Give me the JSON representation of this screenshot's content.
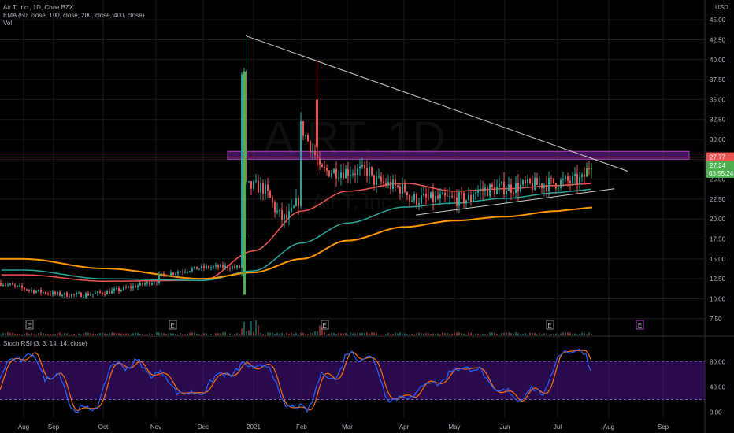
{
  "header": {
    "symbol_line": "Air T, Inc., 1D, Cboe BZX",
    "ema_line": "EMA (50, close, 100, close, 200, close, 400, close)",
    "vol_line": "Vol",
    "watermark": "AIRT, 1D",
    "watermark_sub": "Air T, Inc."
  },
  "currency": "USD",
  "rsi": {
    "legend": "Stoch RSI (3, 3, 14, 14, close)"
  },
  "price_tags": {
    "resistance": "27.77",
    "last_price": "27.24",
    "countdown": "03:55:24"
  },
  "earnings_marker": "E",
  "colors": {
    "bg": "#000000",
    "up": "#26a69a",
    "up_bright": "#4caf50",
    "down": "#ef5350",
    "ema50": "#ef5350",
    "ema100": "#26a69a",
    "ema200": "#ff9800",
    "ema400": "#ff9800",
    "zone_fill": "#7b1fa2",
    "rsi_band": "#4a148c",
    "rsi_k": "#2962ff",
    "rsi_d": "#ff6d00",
    "trendline": "#cccccc"
  },
  "chart_data": [
    {
      "type": "candlestick",
      "title": "Air T, Inc., 1D, Cboe BZX",
      "x_ticks": [
        "Aug",
        "Sep",
        "Oct",
        "Nov",
        "Dec",
        "2021",
        "Feb",
        "Mar",
        "Apr",
        "May",
        "Jun",
        "Jul",
        "Aug",
        "Sep"
      ],
      "y_ticks": [
        7.5,
        10.0,
        12.5,
        15.0,
        17.5,
        20.0,
        22.5,
        25.0,
        27.5,
        30.0,
        32.5,
        35.0,
        37.5,
        40.0,
        42.5,
        45.0
      ],
      "ylim": [
        5.5,
        46.5
      ],
      "series": [
        {
          "name": "EMA 50",
          "points": [
            [
              "Aug",
              13.0
            ],
            [
              "Oct",
              12.2
            ],
            [
              "Dec",
              12.3
            ],
            [
              "2021",
              16.0
            ],
            [
              "Feb",
              21.0
            ],
            [
              "Mar",
              23.5
            ],
            [
              "Apr",
              24.5
            ],
            [
              "May",
              23.5
            ],
            [
              "Jun",
              23.8
            ],
            [
              "Jul",
              24.2
            ]
          ]
        },
        {
          "name": "EMA 100",
          "points": [
            [
              "Aug",
              13.6
            ],
            [
              "Oct",
              12.5
            ],
            [
              "Dec",
              12.3
            ],
            [
              "2021",
              13.5
            ],
            [
              "Feb",
              17.0
            ],
            [
              "Mar",
              19.5
            ],
            [
              "Apr",
              21.5
            ],
            [
              "May",
              22.0
            ],
            [
              "Jun",
              22.6
            ],
            [
              "Jul",
              23.3
            ]
          ]
        },
        {
          "name": "EMA 200",
          "points": [
            [
              "Aug",
              15.0
            ],
            [
              "Oct",
              13.8
            ],
            [
              "Dec",
              12.5
            ],
            [
              "2021",
              13.3
            ],
            [
              "Feb",
              15.0
            ],
            [
              "Mar",
              17.3
            ],
            [
              "Apr",
              19.0
            ],
            [
              "May",
              19.8
            ],
            [
              "Jun",
              20.3
            ],
            [
              "Jul",
              21.0
            ]
          ]
        }
      ],
      "annotations": [
        {
          "type": "horizontal_zone",
          "from": 27.5,
          "to": 28.5
        },
        {
          "type": "horizontal_line",
          "value": 27.77
        },
        {
          "type": "trendline",
          "from": [
            "Dec",
            43.0
          ],
          "to": [
            "Aug",
            26.0
          ]
        },
        {
          "type": "trendline",
          "from": [
            "Apr",
            20.5
          ],
          "to": [
            "Jul",
            23.8
          ]
        }
      ],
      "last_price": 27.24
    },
    {
      "type": "line",
      "title": "Stoch RSI (3, 3, 14, 14, close)",
      "y_ticks": [
        0.0,
        40.0,
        80.0
      ],
      "ylim": [
        -8,
        104
      ],
      "bands": [
        20,
        80
      ]
    }
  ]
}
